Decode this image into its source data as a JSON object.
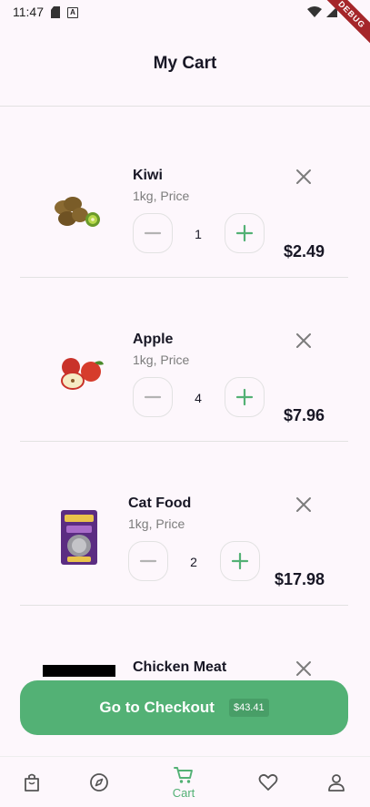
{
  "status": {
    "time": "11:47",
    "debug_label": "DEBUG"
  },
  "header": {
    "title": "My Cart"
  },
  "items": [
    {
      "name": "Kiwi",
      "subtitle": "1kg, Price",
      "quantity": "1",
      "price": "$2.49"
    },
    {
      "name": "Apple",
      "subtitle": "1kg, Price",
      "quantity": "4",
      "price": "$7.96"
    },
    {
      "name": "Cat Food",
      "subtitle": "1kg, Price",
      "quantity": "2",
      "price": "$17.98"
    },
    {
      "name": "Chicken Meat"
    }
  ],
  "checkout": {
    "label": "Go to Checkout",
    "total": "$43.41"
  },
  "nav": {
    "items": [
      {
        "icon": "shop-icon"
      },
      {
        "icon": "explore-icon"
      },
      {
        "icon": "cart-icon",
        "label": "Cart",
        "active": true
      },
      {
        "icon": "favourite-icon"
      },
      {
        "icon": "account-icon"
      }
    ]
  },
  "colors": {
    "accent": "#53b175",
    "text": "#181725",
    "muted": "#7c7c7c",
    "divider": "#e2e2e2",
    "background": "#fdf7fc"
  }
}
